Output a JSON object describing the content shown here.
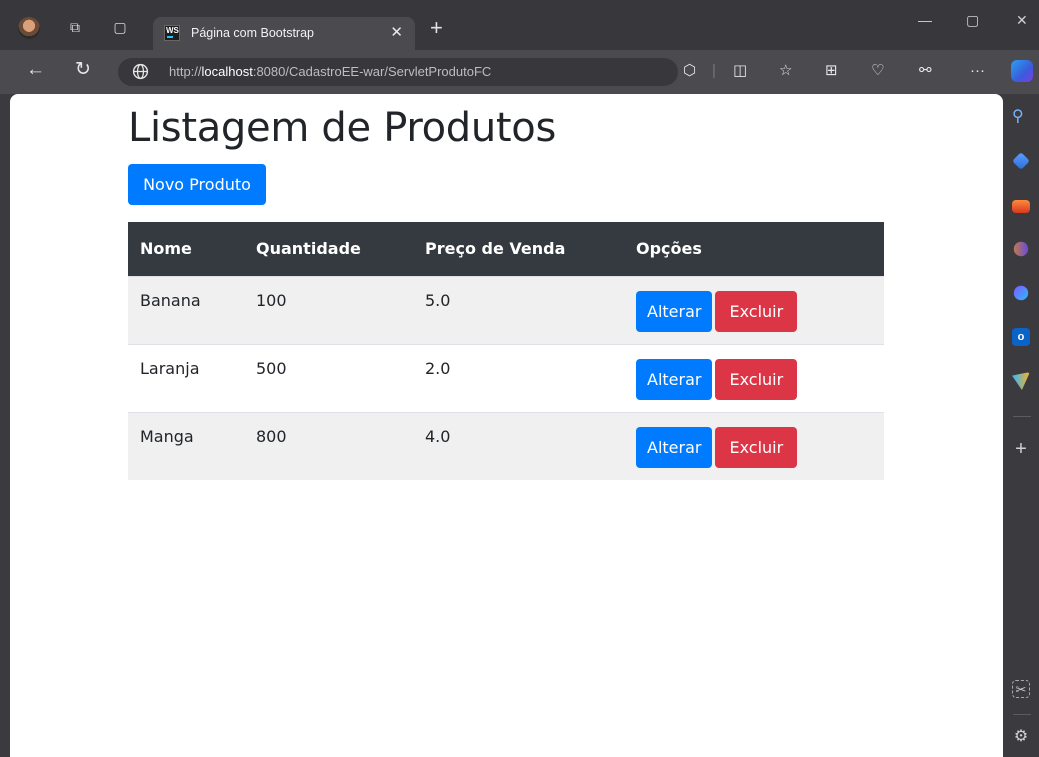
{
  "browser": {
    "tab_title": "Página com Bootstrap",
    "tab_favicon_text": "WS",
    "url_prefix": "http://",
    "url_host": "localhost",
    "url_rest": ":8080/CadastroEE-war/ServletProdutoFC"
  },
  "page": {
    "heading": "Listagem de Produtos",
    "new_button": "Novo Produto",
    "columns": [
      "Nome",
      "Quantidade",
      "Preço de Venda",
      "Opções"
    ],
    "rows": [
      {
        "nome": "Banana",
        "quantidade": "100",
        "preco": "5.0",
        "alterar": "Alterar",
        "excluir": "Excluir"
      },
      {
        "nome": "Laranja",
        "quantidade": "500",
        "preco": "2.0",
        "alterar": "Alterar",
        "excluir": "Excluir"
      },
      {
        "nome": "Manga",
        "quantidade": "800",
        "preco": "4.0",
        "alterar": "Alterar",
        "excluir": "Excluir"
      }
    ]
  },
  "colors": {
    "primary": "#007bff",
    "danger": "#dc3545",
    "table_header": "#343a40",
    "stripe": "#f0f0f0"
  }
}
